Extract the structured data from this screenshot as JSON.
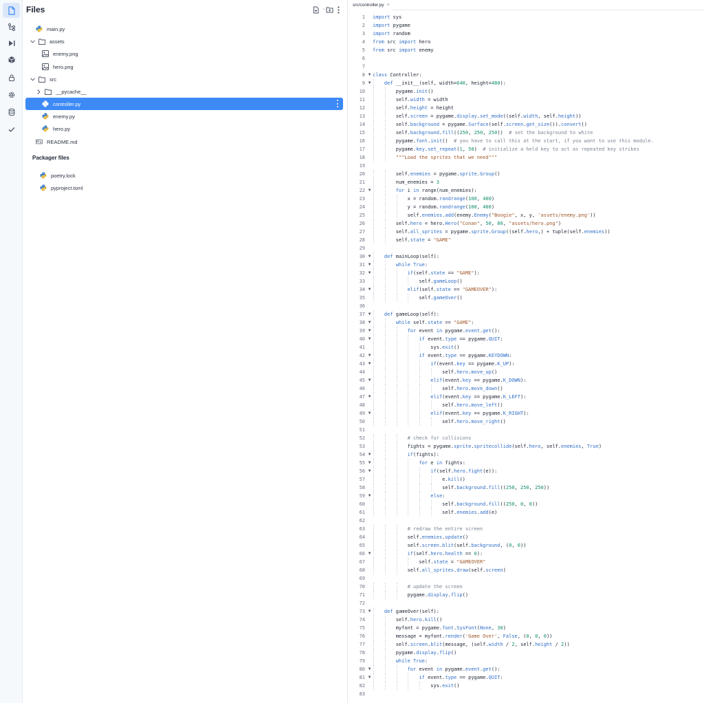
{
  "sidebar": {
    "items": [
      {
        "name": "files-icon"
      },
      {
        "name": "git-icon"
      },
      {
        "name": "run-icon"
      },
      {
        "name": "packages-icon"
      },
      {
        "name": "secrets-lock-icon"
      },
      {
        "name": "settings-gear-icon"
      },
      {
        "name": "database-icon"
      },
      {
        "name": "check-icon"
      }
    ]
  },
  "files_panel": {
    "title": "Files",
    "tree": [
      {
        "label": "main.py",
        "type": "python",
        "depth": 1
      },
      {
        "label": "assets",
        "type": "folder",
        "depth": 0,
        "expanded": true
      },
      {
        "label": "enemy.png",
        "type": "image",
        "depth": 2
      },
      {
        "label": "hero.png",
        "type": "image",
        "depth": 2
      },
      {
        "label": "src",
        "type": "folder",
        "depth": 0,
        "expanded": true
      },
      {
        "label": "__pycache__",
        "type": "folder",
        "depth": 1,
        "expanded": false
      },
      {
        "label": "controller.py",
        "type": "python",
        "depth": 2,
        "selected": true
      },
      {
        "label": "enemy.py",
        "type": "python",
        "depth": 2
      },
      {
        "label": "hero.py",
        "type": "python",
        "depth": 2
      },
      {
        "label": "README.md",
        "type": "markdown",
        "depth": 1
      }
    ],
    "packager_title": "Packager files",
    "packager_files": [
      {
        "label": "poetry.lock",
        "type": "python"
      },
      {
        "label": "pyproject.toml",
        "type": "python"
      }
    ]
  },
  "editor": {
    "tab_label": "src/controller.py",
    "tab_close": "×",
    "colors": {
      "keyword": "#2f6ec8",
      "string": "#a0572a",
      "number": "#0d8a6b",
      "comment": "#7a8494",
      "selection": "#3d8af7"
    },
    "lines": [
      "import sys",
      "import pygame",
      "import random",
      "from src import hero",
      "from src import enemy",
      "",
      "",
      "class Controller:",
      "    def __init__(self, width=640, height=480):",
      "        pygame.init()",
      "        self.width = width",
      "        self.height = height",
      "        self.screen = pygame.display.set_mode((self.width, self.height))",
      "        self.background = pygame.Surface(self.screen.get_size()).convert()",
      "        self.background.fill((250, 250, 250))  # set the background to white",
      "        pygame.font.init()  # you have to call this at the start, if you want to use this module.",
      "        pygame.key.set_repeat(1, 50)  # initialize a held key to act as repeated key strikes",
      "        \"\"\"Load the sprites that we need\"\"\"",
      "",
      "        self.enemies = pygame.sprite.Group()",
      "        num_enemies = 3",
      "        for i in range(num_enemies):",
      "            x = random.randrange(100, 400)",
      "            y = random.randrange(100, 400)",
      "            self.enemies.add(enemy.Enemy(\"Boogie\", x, y, 'assets/enemy.png'))",
      "        self.hero = hero.Hero(\"Conan\", 50, 80, \"assets/hero.png\")",
      "        self.all_sprites = pygame.sprite.Group((self.hero,) + tuple(self.enemies))",
      "        self.state = \"GAME\"",
      "",
      "    def mainLoop(self):",
      "        while True:",
      "            if(self.state == \"GAME\"):",
      "                self.gameLoop()",
      "            elif(self.state == \"GAMEOVER\"):",
      "                self.gameOver()",
      "",
      "    def gameLoop(self):",
      "        while self.state == \"GAME\":",
      "            for event in pygame.event.get():",
      "                if event.type == pygame.QUIT:",
      "                    sys.exit()",
      "                if event.type == pygame.KEYDOWN:",
      "                    if(event.key == pygame.K_UP):",
      "                        self.hero.move_up()",
      "                    elif(event.key == pygame.K_DOWN):",
      "                        self.hero.move_down()",
      "                    elif(event.key == pygame.K_LEFT):",
      "                        self.hero.move_left()",
      "                    elif(event.key == pygame.K_RIGHT):",
      "                        self.hero.move_right()",
      "",
      "            # check for collisions",
      "            fights = pygame.sprite.spritecollide(self.hero, self.enemies, True)",
      "            if(fights):",
      "                for e in fights:",
      "                    if(self.hero.fight(e)):",
      "                        e.kill()",
      "                        self.background.fill((250, 250, 250))",
      "                    else:",
      "                        self.background.fill((250, 0, 0))",
      "                        self.enemies.add(e)",
      "",
      "            # redraw the entire screen",
      "            self.enemies.update()",
      "            self.screen.blit(self.background, (0, 0))",
      "            if(self.hero.health == 0):",
      "                self.state = \"GAMEOVER\"",
      "            self.all_sprites.draw(self.screen)",
      "",
      "            # update the screen",
      "            pygame.display.flip()",
      "",
      "    def gameOver(self):",
      "        self.hero.kill()",
      "        myfont = pygame.font.SysFont(None, 30)",
      "        message = myfont.render('Game Over', False, (0, 0, 0))",
      "        self.screen.blit(message, (self.width / 2, self.height / 2))",
      "        pygame.display.flip()",
      "        while True:",
      "            for event in pygame.event.get():",
      "                if event.type == pygame.QUIT:",
      "                    sys.exit()",
      ""
    ],
    "fold_lines": [
      8,
      9,
      22,
      30,
      31,
      32,
      34,
      37,
      38,
      39,
      40,
      42,
      43,
      45,
      47,
      49,
      54,
      55,
      56,
      59,
      66,
      73,
      80,
      81
    ],
    "fold_marker": "▼"
  }
}
